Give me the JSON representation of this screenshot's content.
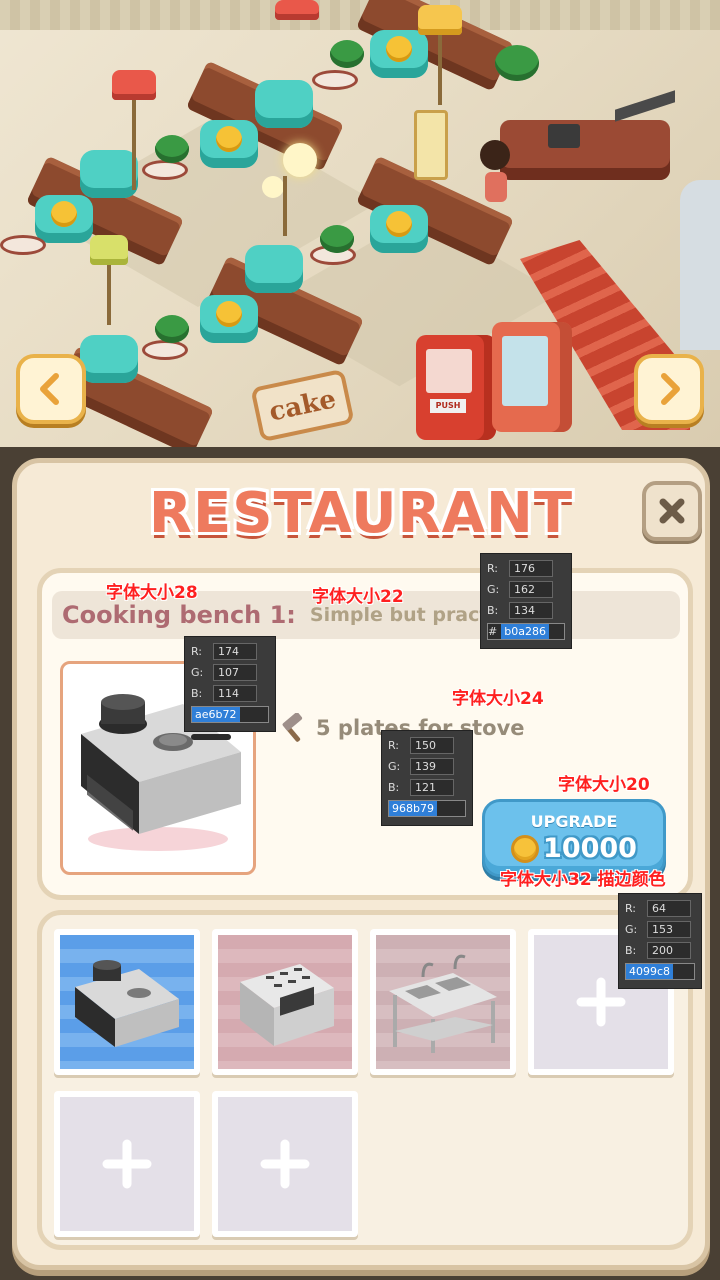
{
  "scene": {
    "sign_text": "cake",
    "prev_icon": "chevron-left-icon",
    "next_icon": "chevron-right-icon",
    "vending_text": "PUSH"
  },
  "panel": {
    "title": "RESTAURANT",
    "close_icon": "close-icon",
    "bench": {
      "name": "Cooking bench 1:",
      "description": "Simple but practical",
      "perk_icon": "hammer-icon",
      "perk_text": "5 plates for stove",
      "upgrade_label": "UPGRADE",
      "coin_icon": "coin-icon",
      "price": "10000"
    },
    "slots": [
      {
        "item": "stove",
        "bg": "blue",
        "selected": true
      },
      {
        "item": "oven",
        "bg": "pink"
      },
      {
        "item": "sink",
        "bg": "rose"
      },
      {
        "item": "add",
        "bg": "empty"
      },
      {
        "item": "add",
        "bg": "empty"
      },
      {
        "item": "add",
        "bg": "empty"
      }
    ]
  },
  "annotations": {
    "font_28": "字体大小28",
    "font_22": "字体大小22",
    "font_24": "字体大小24",
    "font_20": "字体大小20",
    "font_32": "字体大小32 描边颜色",
    "picker_desc": {
      "r": "176",
      "g": "162",
      "b": "134",
      "hex": "b0a286"
    },
    "picker_name": {
      "r": "174",
      "g": "107",
      "b": "114",
      "hex": "ae6b72"
    },
    "picker_perk": {
      "r": "150",
      "g": "139",
      "b": "121",
      "hex": "968b79"
    },
    "picker_stroke": {
      "r": "64",
      "g": "153",
      "b": "200",
      "hex": "4099c8"
    },
    "labels": {
      "r": "R:",
      "g": "G:",
      "b": "B:",
      "hash": "#"
    }
  },
  "colors": {
    "title": "#ee7a5e",
    "name": "#ae6b72",
    "desc": "#b0a286",
    "perk": "#968b79",
    "stroke": "#4099c8"
  }
}
